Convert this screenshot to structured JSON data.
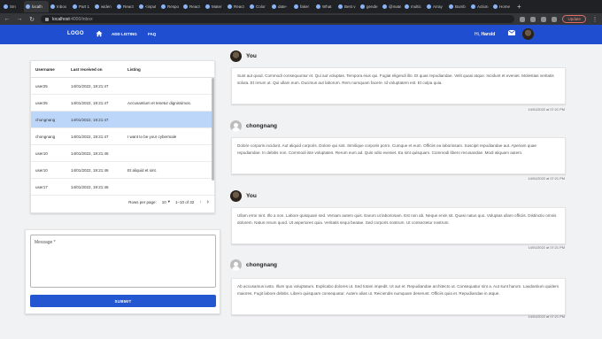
{
  "browser": {
    "tabs": [
      {
        "label": "Sm"
      },
      {
        "label": "localh"
      },
      {
        "label": "Inbox"
      },
      {
        "label": "Part 1"
      },
      {
        "label": "widen"
      },
      {
        "label": "React"
      },
      {
        "label": "<input"
      },
      {
        "label": "Respo"
      },
      {
        "label": "React"
      },
      {
        "label": "Mater"
      },
      {
        "label": "React"
      },
      {
        "label": "Color"
      },
      {
        "label": "date-"
      },
      {
        "label": "faker"
      },
      {
        "label": "What"
      },
      {
        "label": "Best v"
      },
      {
        "label": "gende"
      },
      {
        "label": "@mate"
      },
      {
        "label": "multic"
      },
      {
        "label": "Array"
      },
      {
        "label": "Bumb"
      },
      {
        "label": "Action"
      },
      {
        "label": "Home"
      }
    ],
    "url_host": "localhost",
    "url_path": ":4000/inbox",
    "update_label": "Update"
  },
  "appbar": {
    "logo": "LOGO",
    "links": [
      "ADD LISTING",
      "FAQ"
    ],
    "greeting": "Hi,",
    "username": "Harold"
  },
  "inbox": {
    "columns": [
      "Username",
      "Last received on",
      "Listing"
    ],
    "rows": [
      {
        "user": "user25",
        "date": "14/01/2022, 19:21:47",
        "listing": ""
      },
      {
        "user": "user25",
        "date": "14/01/2022, 19:21:47",
        "listing": "Accusantium et tenetur dignissimos."
      },
      {
        "user": "chongnang",
        "date": "14/01/2022, 19:21:47",
        "listing": ""
      },
      {
        "user": "chongnang",
        "date": "14/01/2022, 19:21:47",
        "listing": "I want to be your cybermale"
      },
      {
        "user": "user10",
        "date": "14/01/2022, 19:21:46",
        "listing": ""
      },
      {
        "user": "user10",
        "date": "14/01/2022, 19:21:46",
        "listing": "Et aliquid et sint."
      },
      {
        "user": "user17",
        "date": "14/01/2022, 19:21:46",
        "listing": ""
      }
    ],
    "selected_index": 2,
    "rows_per_page_label": "Rows per page:",
    "rows_per_page": "10",
    "range": "1–10 of 32"
  },
  "compose": {
    "placeholder": "Message *",
    "submit_label": "SUBMIT"
  },
  "messages": [
    {
      "author": "You",
      "avatar": "photo",
      "text": "Sunt aut quod. Commodi consequuntur et. Qui aut voluptas. Tempora eius qui. Fugiat eligendi illo. Et quas repudiandae. Velit quasi atque. Incidunt et eveniet. Molestias veritatis soluta. Et rerum ut. Qui ullam eum. Ducimus aut laborum. Rem numquam facere. Id voluptatem est. Et culpa quia.",
      "time": "14/01/2022 at 07:21 PM"
    },
    {
      "author": "chongnang",
      "avatar": "grey",
      "text": "Dolore corporis incidunt. Aut aliquid corporis. Dolore qui sint. Similique corporis porro. Cumque et eum. Officiis ea laboriosam. Suscipit repudiandae aut. Aperiam quae repudiandae. In debitis non. Commodi iste voluptates. Rerum eum ad. Quis odio eveniet. Ea sint quisquam. Commodi libero recusandae. Modi aliquam autem.",
      "time": "14/01/2022 at 07:21 PM"
    },
    {
      "author": "You",
      "avatar": "photo",
      "text": "Ullam error sint. Illo a non. Labore quisquam sed. Veniam autem quis. Earum ut laboriosam. Est non ab. Neque enim sit. Quasi natus quo. Voluptas ullam officiis. Distinctio omnis dolorem. Natus rerum quod. Ut asperiores quia. Veritatis sequi beatae. Sed corporis nostrum. Ut consectetur nostrum.",
      "time": "14/01/2022 at 07:21 PM"
    },
    {
      "author": "chongnang",
      "avatar": "grey",
      "text": "Ab accusamus iusto. Illum quo voluptatum. Explicabo dolores ut. Sed totam impedit. Ut aut et. Repudiandae architecto ut. Consequatur sint a. Aut sunt harum. Laudantium quidem maiores. Fugit labore debitis. Libero quisquam consequatur. Autem alias ut. Reiciendis numquam deserunt. Officiis quia et. Repudiandae in atque.",
      "time": "14/01/2022 at 07:21 PM"
    }
  ]
}
